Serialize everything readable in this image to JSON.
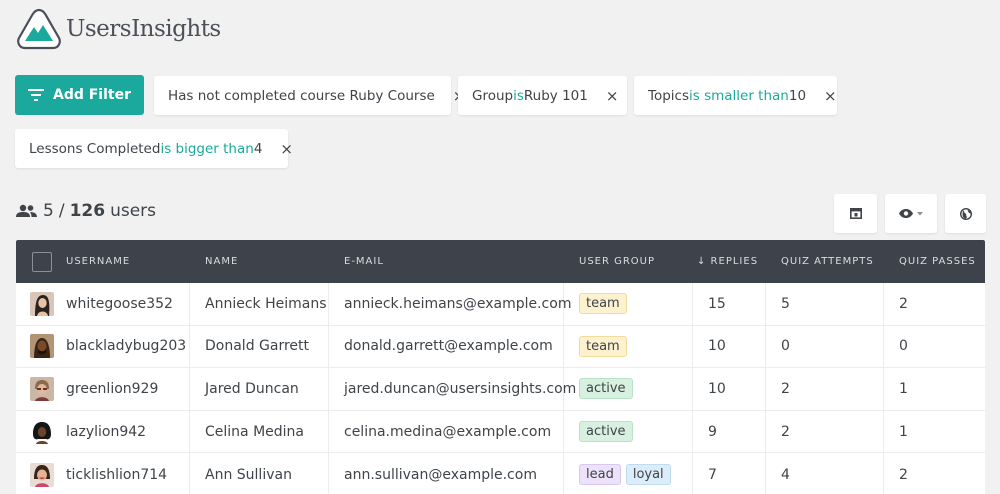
{
  "app": {
    "name": "UsersInsights",
    "accent": "#1ba99d"
  },
  "toolbar": {
    "add_filter_label": "Add Filter"
  },
  "filters": [
    {
      "text": "Has not completed course Ruby Course",
      "op": "",
      "value": ""
    },
    {
      "text": "Group ",
      "op": "is",
      "value": " Ruby 101"
    },
    {
      "text": "Topics ",
      "op": "is smaller than",
      "value": " 10"
    },
    {
      "text": "Lessons Completed ",
      "op": "is bigger than",
      "value": " 4"
    }
  ],
  "filter_remove_glyph": "×",
  "summary": {
    "shown": "5",
    "separator": "/",
    "total": "126",
    "unit": "users"
  },
  "columns": {
    "username": "Username",
    "name": "Name",
    "email": "E-mail",
    "user_group": "User Group",
    "replies": "↓ Replies",
    "quiz_attempts": "Quiz Attempts",
    "quiz_passes": "Quiz Passes"
  },
  "rows": [
    {
      "username": "whitegoose352",
      "name": "Annieck Heimans",
      "email": "annieck.heimans@example.com",
      "groups": [
        "team"
      ],
      "replies": "15",
      "quiz_attempts": "5",
      "quiz_passes": "2"
    },
    {
      "username": "blackladybug203",
      "name": "Donald Garrett",
      "email": "donald.garrett@example.com",
      "groups": [
        "team"
      ],
      "replies": "10",
      "quiz_attempts": "0",
      "quiz_passes": "0"
    },
    {
      "username": "greenlion929",
      "name": "Jared Duncan",
      "email": "jared.duncan@usersinsights.com",
      "groups": [
        "active"
      ],
      "replies": "10",
      "quiz_attempts": "2",
      "quiz_passes": "1"
    },
    {
      "username": "lazylion942",
      "name": "Celina Medina",
      "email": "celina.medina@example.com",
      "groups": [
        "active"
      ],
      "replies": "9",
      "quiz_attempts": "2",
      "quiz_passes": "1"
    },
    {
      "username": "ticklishlion714",
      "name": "Ann Sullivan",
      "email": "ann.sullivan@example.com",
      "groups": [
        "lead",
        "loyal"
      ],
      "replies": "7",
      "quiz_attempts": "4",
      "quiz_passes": "2"
    }
  ],
  "tag_colors": {
    "team": {
      "bg": "#fdf1cf",
      "border": "#f2dc9c"
    },
    "active": {
      "bg": "#d8f0df",
      "border": "#b8e2c5"
    },
    "lead": {
      "bg": "#ece2f9",
      "border": "#d9c7f2"
    },
    "loyal": {
      "bg": "#dcedf9",
      "border": "#bddcf1"
    }
  },
  "icons": {
    "logo": "mountain-logo-icon",
    "add_filter": "filter-lines-icon",
    "users": "users-group-icon",
    "columns": "layout-columns-icon",
    "visibility": "eye-icon",
    "globe": "globe-icon"
  }
}
